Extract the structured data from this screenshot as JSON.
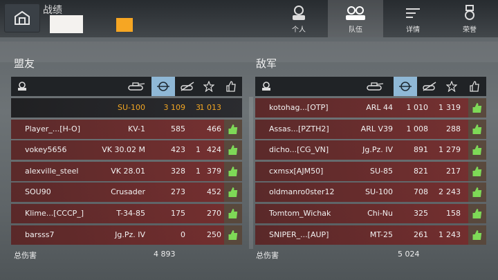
{
  "header": {
    "battle_title": "战绩",
    "tabs": [
      {
        "label": "个人",
        "icon": "single-tank-crew-icon",
        "active": false
      },
      {
        "label": "队伍",
        "icon": "team-crew-icon",
        "active": true
      },
      {
        "label": "详情",
        "icon": "details-lines-icon",
        "active": false
      },
      {
        "label": "荣誉",
        "icon": "medal-icon",
        "active": false
      }
    ]
  },
  "allies": {
    "title": "盟友",
    "rows": [
      {
        "name": "",
        "tank": "SU-100",
        "damage": "3 109",
        "kills": "3",
        "score": "1 013",
        "me": true
      },
      {
        "name": "Player_...[H-O]",
        "tank": "KV-1",
        "damage": "585",
        "kills": "",
        "score": "466"
      },
      {
        "name": "vokey5656",
        "tank": "VK 30.02 M",
        "damage": "423",
        "kills": "1",
        "score": "424"
      },
      {
        "name": "alexville_steel",
        "tank": "VK 28.01",
        "damage": "328",
        "kills": "1",
        "score": "379"
      },
      {
        "name": "SOU90",
        "tank": "Crusader",
        "damage": "273",
        "kills": "",
        "score": "452"
      },
      {
        "name": "Klime...[CCCP_]",
        "tank": "T-34-85",
        "damage": "175",
        "kills": "",
        "score": "270"
      },
      {
        "name": "barsss7",
        "tank": "Jg.Pz. IV",
        "damage": "0",
        "kills": "",
        "score": "250"
      }
    ],
    "total_label": "总伤害",
    "total_damage": "4 893"
  },
  "enemies": {
    "title": "敌军",
    "rows": [
      {
        "name": "kotohag...[OTP]",
        "tank": "ARL 44",
        "damage": "1 010",
        "kills": "1",
        "score": "319"
      },
      {
        "name": "Assas...[PZTH2]",
        "tank": "ARL V39",
        "damage": "1 008",
        "kills": "",
        "score": "288"
      },
      {
        "name": "dicho...[CG_VN]",
        "tank": "Jg.Pz. IV",
        "damage": "891",
        "kills": "1",
        "score": "279"
      },
      {
        "name": "cxmsx[AJM50]",
        "tank": "SU-85",
        "damage": "821",
        "kills": "",
        "score": "217"
      },
      {
        "name": "oldmanro0ster12",
        "tank": "SU-100",
        "damage": "708",
        "kills": "2",
        "score": "243"
      },
      {
        "name": "Tomtom_Wichak",
        "tank": "Chi-Nu",
        "damage": "325",
        "kills": "",
        "score": "158"
      },
      {
        "name": "SNIPER_...[AUP]",
        "tank": "MT-25",
        "damage": "261",
        "kills": "1",
        "score": "243"
      }
    ],
    "total_label": "总伤害",
    "total_damage": "5 024"
  },
  "colors": {
    "like_green": "#7ed957",
    "self_highlight": "#f2a623",
    "selected_header": "#8fb8d6"
  }
}
